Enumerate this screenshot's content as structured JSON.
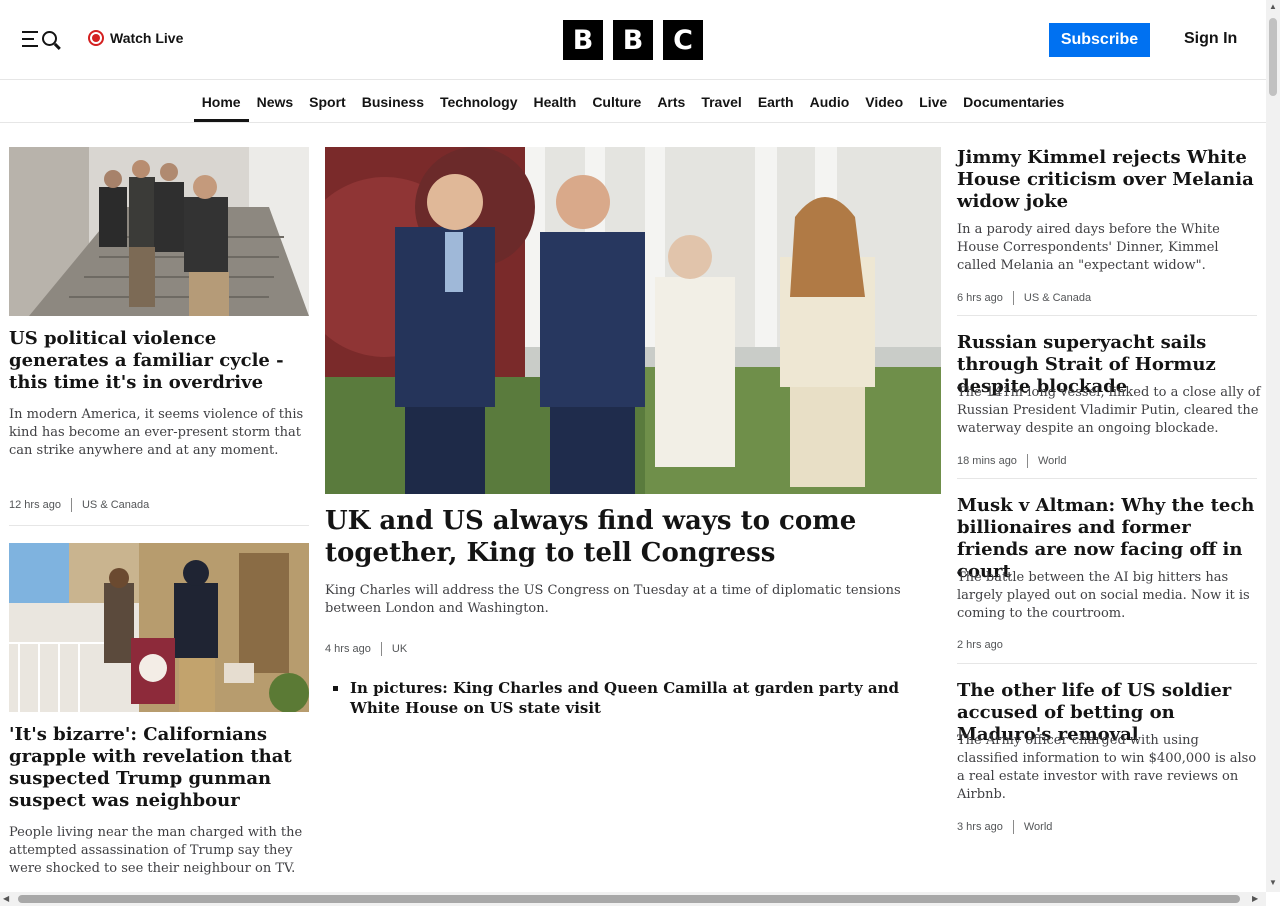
{
  "header": {
    "watch_live": "Watch Live",
    "logo_letters": [
      "B",
      "B",
      "C"
    ],
    "subscribe": "Subscribe",
    "sign_in": "Sign In",
    "live_color": "#d42020",
    "subscribe_color": "#0071f1"
  },
  "nav": {
    "items": [
      "Home",
      "News",
      "Sport",
      "Business",
      "Technology",
      "Health",
      "Culture",
      "Arts",
      "Travel",
      "Earth",
      "Audio",
      "Video",
      "Live",
      "Documentaries"
    ],
    "active": "Home"
  },
  "left": [
    {
      "title": "US political violence generates a familiar cycle - this time it's in overdrive",
      "summary": "In modern America, it seems violence of this kind has become an ever-present storm that can strike anywhere and at any moment.",
      "time": "12 hrs ago",
      "section": "US & Canada"
    },
    {
      "title": "'It's bizarre': Californians grapple with revelation that suspected Trump gunman suspect was neighbour",
      "summary": "People living near the man charged with the attempted assassination of Trump say they were shocked to see their neighbour on TV."
    }
  ],
  "main": {
    "title": "UK and US always find ways to come together, King to tell Congress",
    "summary": "King Charles will address the US Congress on Tuesday at a time of diplomatic tensions between London and Washington.",
    "time": "4 hrs ago",
    "section": "UK",
    "related": "In pictures: King Charles and Queen Camilla at garden party and White House on US state visit"
  },
  "right": [
    {
      "title": "Jimmy Kimmel rejects White House criticism over Melania widow joke",
      "summary": "In a parody aired days before the White House Correspondents' Dinner, Kimmel called Melania an \"expectant widow\".",
      "time": "6 hrs ago",
      "section": "US & Canada"
    },
    {
      "title": "Russian superyacht sails through Strait of Hormuz despite blockade",
      "summary": "The 141m-long vessel, linked to a close ally of Russian President Vladimir Putin, cleared the waterway despite an ongoing blockade.",
      "time": "18 mins ago",
      "section": "World"
    },
    {
      "title": "Musk v Altman: Why the tech billionaires and former friends are now facing off in court",
      "summary": "The battle between the AI big hitters has largely played out on social media. Now it is coming to the courtroom.",
      "time": "2 hrs ago"
    },
    {
      "title": "The other life of US soldier accused of betting on Maduro's removal",
      "summary": "The Army officer charged with using classified information to win $400,000 is also a real estate investor with rave reviews on Airbnb.",
      "time": "3 hrs ago",
      "section": "World"
    }
  ]
}
